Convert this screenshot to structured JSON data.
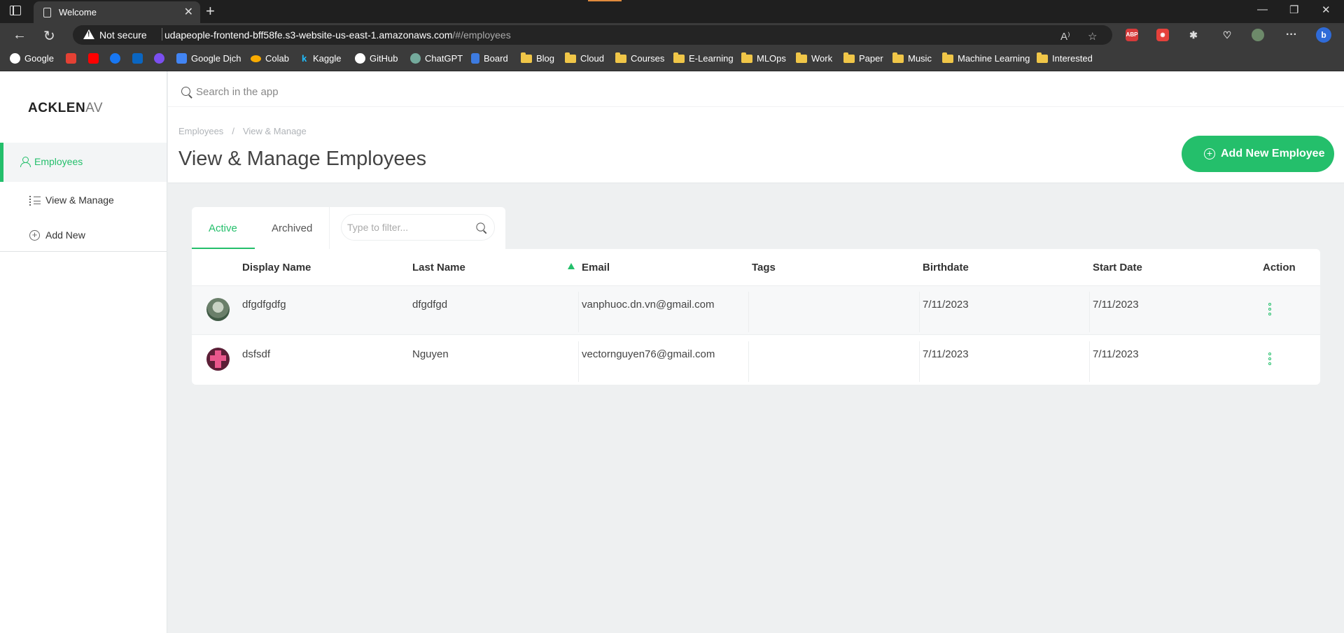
{
  "browser": {
    "tab_title": "Welcome",
    "security_label": "Not secure",
    "url_host": "udapeople-frontend-bff58fe.s3-website-us-east-1.amazonaws.com",
    "url_path": "/#/employees",
    "extensions": [
      "ABP",
      "record",
      "puzzle",
      "health",
      "profile",
      "more",
      "bing"
    ],
    "bookmarks": [
      {
        "label": "Google",
        "icon": "google-icon"
      },
      {
        "label": "",
        "icon": "gmail-icon"
      },
      {
        "label": "",
        "icon": "youtube-icon"
      },
      {
        "label": "",
        "icon": "facebook-icon"
      },
      {
        "label": "",
        "icon": "linkedin-icon"
      },
      {
        "label": "",
        "icon": "messenger-icon"
      },
      {
        "label": "Google Dịch",
        "icon": "translate-icon"
      },
      {
        "label": "Colab",
        "icon": "colab-icon"
      },
      {
        "label": "Kaggle",
        "icon": "kaggle-icon"
      },
      {
        "label": "GitHub",
        "icon": "github-icon"
      },
      {
        "label": "ChatGPT",
        "icon": "chatgpt-icon"
      },
      {
        "label": "Board",
        "icon": "board-icon"
      },
      {
        "label": "Blog",
        "icon": "folder-icon"
      },
      {
        "label": "Cloud",
        "icon": "folder-icon"
      },
      {
        "label": "Courses",
        "icon": "folder-icon"
      },
      {
        "label": "E-Learning",
        "icon": "folder-icon"
      },
      {
        "label": "MLOps",
        "icon": "folder-icon"
      },
      {
        "label": "Work",
        "icon": "folder-icon"
      },
      {
        "label": "Paper",
        "icon": "folder-icon"
      },
      {
        "label": "Music",
        "icon": "folder-icon"
      },
      {
        "label": "Machine Learning",
        "icon": "folder-icon"
      },
      {
        "label": "Interested",
        "icon": "folder-icon"
      }
    ]
  },
  "app": {
    "logo_bold": "ACKLEN",
    "logo_light": "AV",
    "accent_color": "#24bf6b",
    "search_placeholder": "Search in the app",
    "sidebar": {
      "section": "Employees",
      "items": [
        {
          "label": "View & Manage",
          "icon": "list-icon"
        },
        {
          "label": "Add New",
          "icon": "plus-circle-icon"
        }
      ]
    },
    "breadcrumb": [
      "Employees",
      "View & Manage"
    ],
    "page_title": "View & Manage Employees",
    "add_button": "Add New Employee",
    "tabs": [
      "Active",
      "Archived"
    ],
    "filter_placeholder": "Type to filter...",
    "table": {
      "columns": [
        "Display Name",
        "Last Name",
        "Email",
        "Tags",
        "Birthdate",
        "Start Date",
        "Action"
      ],
      "sort_column": "Email",
      "sort_direction": "ascending",
      "rows": [
        {
          "display_name": "dfgdfgdfg",
          "last_name": "dfgdfgd",
          "email": "vanphuoc.dn.vn@gmail.com",
          "tags": "",
          "birthdate": "7/11/2023",
          "start_date": "7/11/2023"
        },
        {
          "display_name": "dsfsdf",
          "last_name": "Nguyen",
          "email": "vectornguyen76@gmail.com",
          "tags": "",
          "birthdate": "7/11/2023",
          "start_date": "7/11/2023"
        }
      ]
    }
  }
}
